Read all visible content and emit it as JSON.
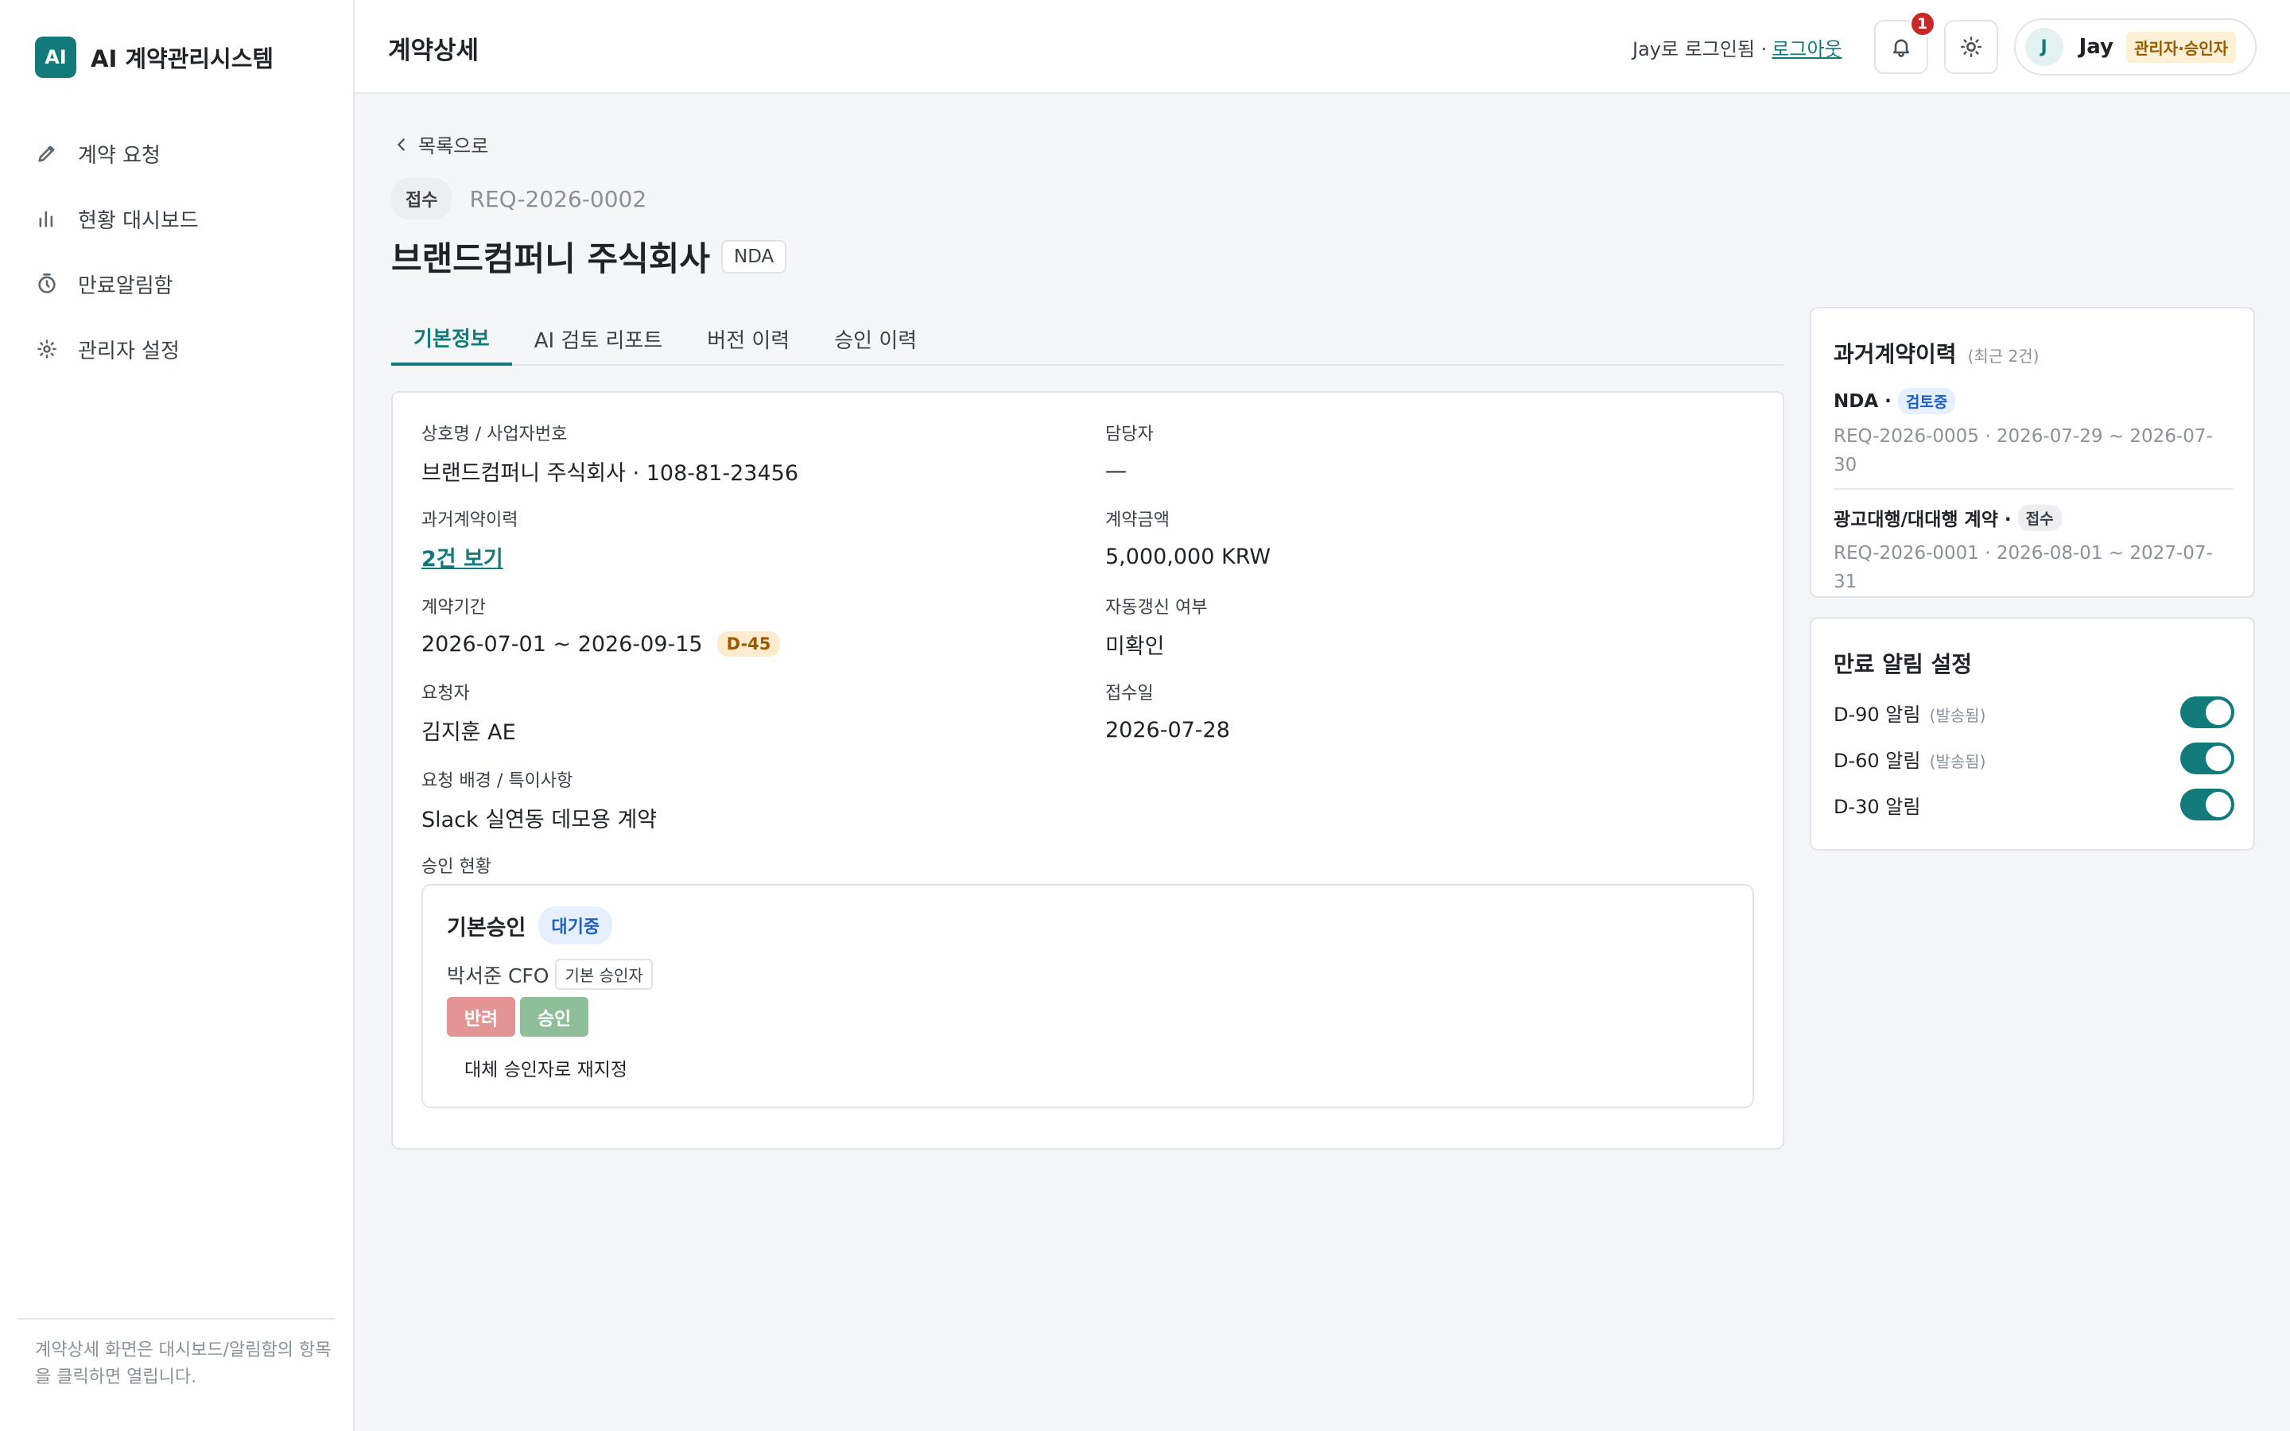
{
  "app": {
    "logo_text": "AI",
    "name": "AI 계약관리시스템"
  },
  "sidebar": {
    "items": [
      {
        "label": "계약 요청",
        "icon": "pencil-icon"
      },
      {
        "label": "현황 대시보드",
        "icon": "bar-chart-icon"
      },
      {
        "label": "만료알림함",
        "icon": "timer-icon"
      },
      {
        "label": "관리자 설정",
        "icon": "gear-icon"
      }
    ],
    "footer_text": "계약상세 화면은 대시보드/알림함의 항목을 클릭하면 열립니다."
  },
  "header": {
    "title": "계약상세",
    "login_text": "Jay로 로그인됨 ·",
    "logout_label": "로그아웃",
    "notification_count": "1",
    "user": {
      "avatar_initial": "J",
      "name": "Jay",
      "role": "관리자·승인자"
    }
  },
  "detail": {
    "back_label": "목록으로",
    "status": "접수",
    "request_id": "REQ-2026-0002",
    "company_title": "브랜드컴퍼니 주식회사",
    "contract_type": "NDA",
    "tabs": [
      {
        "label": "기본정보",
        "active": true
      },
      {
        "label": "AI 검토 리포트",
        "active": false
      },
      {
        "label": "버전 이력",
        "active": false
      },
      {
        "label": "승인 이력",
        "active": false
      }
    ],
    "fields": {
      "company": {
        "label": "상호명 / 사업자번호",
        "value": "브랜드컴퍼니 주식회사 · 108-81-23456"
      },
      "manager": {
        "label": "담당자",
        "value": "—"
      },
      "past_contracts": {
        "label": "과거계약이력",
        "value": "2건 보기"
      },
      "amount": {
        "label": "계약금액",
        "value": "5,000,000 KRW"
      },
      "period": {
        "label": "계약기간",
        "value": "2026-07-01 ~ 2026-09-15",
        "dday": "D-45"
      },
      "auto_renew": {
        "label": "자동갱신 여부",
        "value": "미확인"
      },
      "requester": {
        "label": "요청자",
        "value": "김지훈 AE"
      },
      "received_date": {
        "label": "접수일",
        "value": "2026-07-28"
      },
      "background": {
        "label": "요청 배경 / 특이사항",
        "value": "Slack 실연동 데모용 계약"
      },
      "approval_label": "승인 현황"
    },
    "approval": {
      "title": "기본승인",
      "status": "대기중",
      "approver": "박서준 CFO",
      "approver_role": "기본 승인자",
      "reject_label": "반려",
      "approve_label": "승인",
      "reassign_label": "대체 승인자로 재지정"
    }
  },
  "past_history": {
    "title": "과거계약이력",
    "subtitle": "(최근 2건)",
    "items": [
      {
        "title": "NDA ·",
        "status": "검토중",
        "meta": "REQ-2026-0005 · 2026-07-29 ~ 2026-07-30"
      },
      {
        "title": "광고대행/대대행 계약 ·",
        "status": "접수",
        "meta": "REQ-2026-0001 · 2026-08-01 ~ 2027-07-31"
      }
    ]
  },
  "expiry_alerts": {
    "title": "만료 알림 설정",
    "items": [
      {
        "label": "D-90 알림",
        "note": "(발송됨)",
        "enabled": true
      },
      {
        "label": "D-60 알림",
        "note": "(발송됨)",
        "enabled": true
      },
      {
        "label": "D-30 알림",
        "note": "",
        "enabled": true
      }
    ]
  },
  "colors": {
    "brand": "#127a7a",
    "danger": "#c62828",
    "warning_bg": "#fdebcf",
    "info_bg": "#e5efff"
  }
}
